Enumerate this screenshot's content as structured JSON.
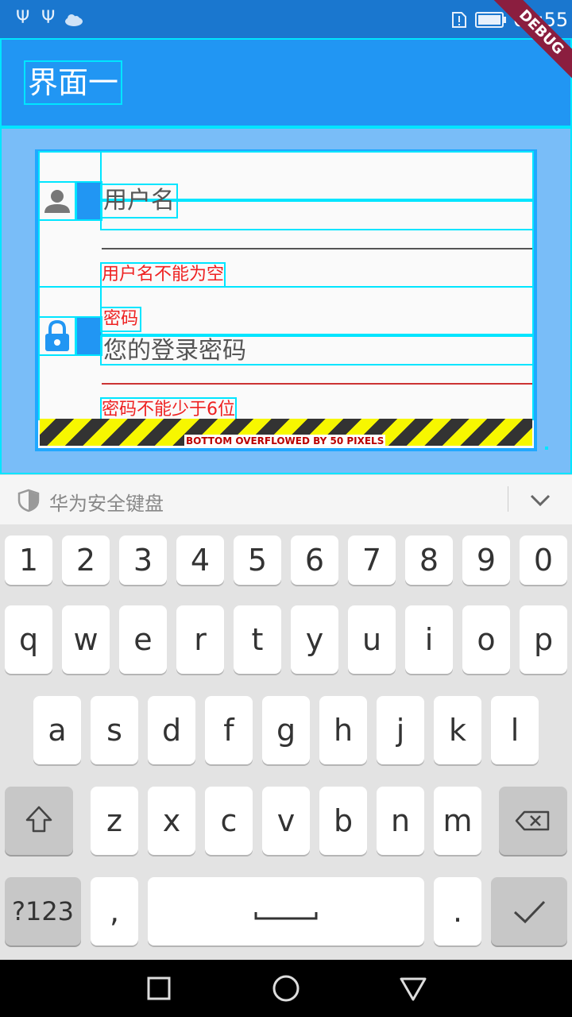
{
  "status": {
    "time": "09:55"
  },
  "debug_banner": "DEBUG",
  "appbar": {
    "title": "界面一"
  },
  "form": {
    "username": {
      "placeholder": "用户名",
      "error": "用户名不能为空"
    },
    "password": {
      "label": "密码",
      "placeholder": "您的登录密码",
      "error": "密码不能少于6位"
    },
    "overflow_warning": "BOTTOM OVERFLOWED BY 50 PIXELS"
  },
  "keyboard": {
    "name": "华为安全键盘",
    "row_numbers": [
      "1",
      "2",
      "3",
      "4",
      "5",
      "6",
      "7",
      "8",
      "9",
      "0"
    ],
    "row_top": [
      "q",
      "w",
      "e",
      "r",
      "t",
      "y",
      "u",
      "i",
      "o",
      "p"
    ],
    "row_mid": [
      "a",
      "s",
      "d",
      "f",
      "g",
      "h",
      "j",
      "k",
      "l"
    ],
    "row_bottom": [
      "z",
      "x",
      "c",
      "v",
      "b",
      "n",
      "m"
    ],
    "symbols_label": "?123",
    "comma": ",",
    "period": "."
  },
  "colors": {
    "appbar": "#2196f3",
    "error": "#e22222",
    "debug": "#8b1e3f"
  }
}
